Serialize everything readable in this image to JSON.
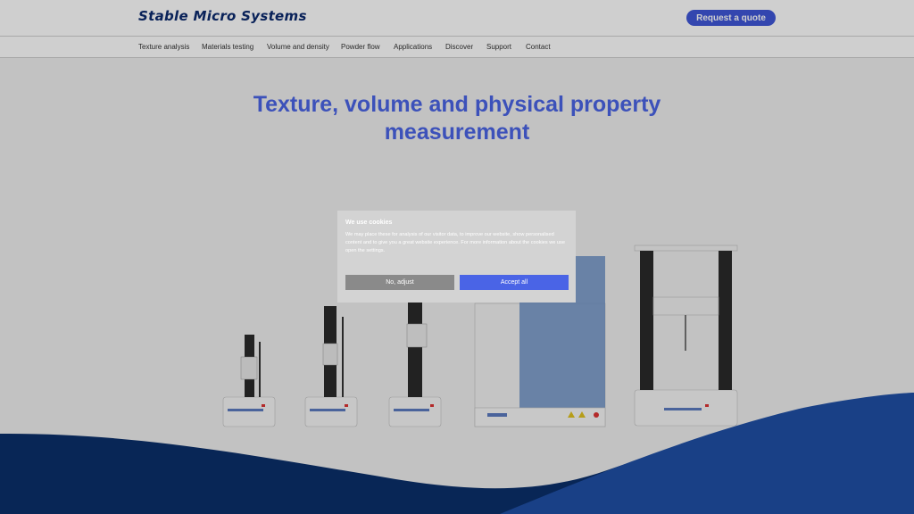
{
  "header": {
    "logo": "Stable Micro Systems",
    "cta_label": "Request a quote"
  },
  "nav": {
    "items": [
      "Texture analysis",
      "Materials testing",
      "Volume and density",
      "Powder flow",
      "Applications",
      "Discover",
      "Support",
      "Contact"
    ]
  },
  "hero": {
    "title": "Texture, volume and physical property measurement"
  },
  "cookie": {
    "title": "We use cookies",
    "text": "We may place these for analysis of our visitor data, to improve our website, show personalised content and to give you a great website experience. For more information about the cookies we use open the settings.",
    "adjust_label": "No, adjust",
    "accept_label": "Accept all"
  },
  "colors": {
    "brand_blue": "#4a64e6",
    "logo_navy": "#0c2a6e",
    "wave_navy": "#0b2f6b",
    "wave_blue": "#1f4fa6"
  }
}
